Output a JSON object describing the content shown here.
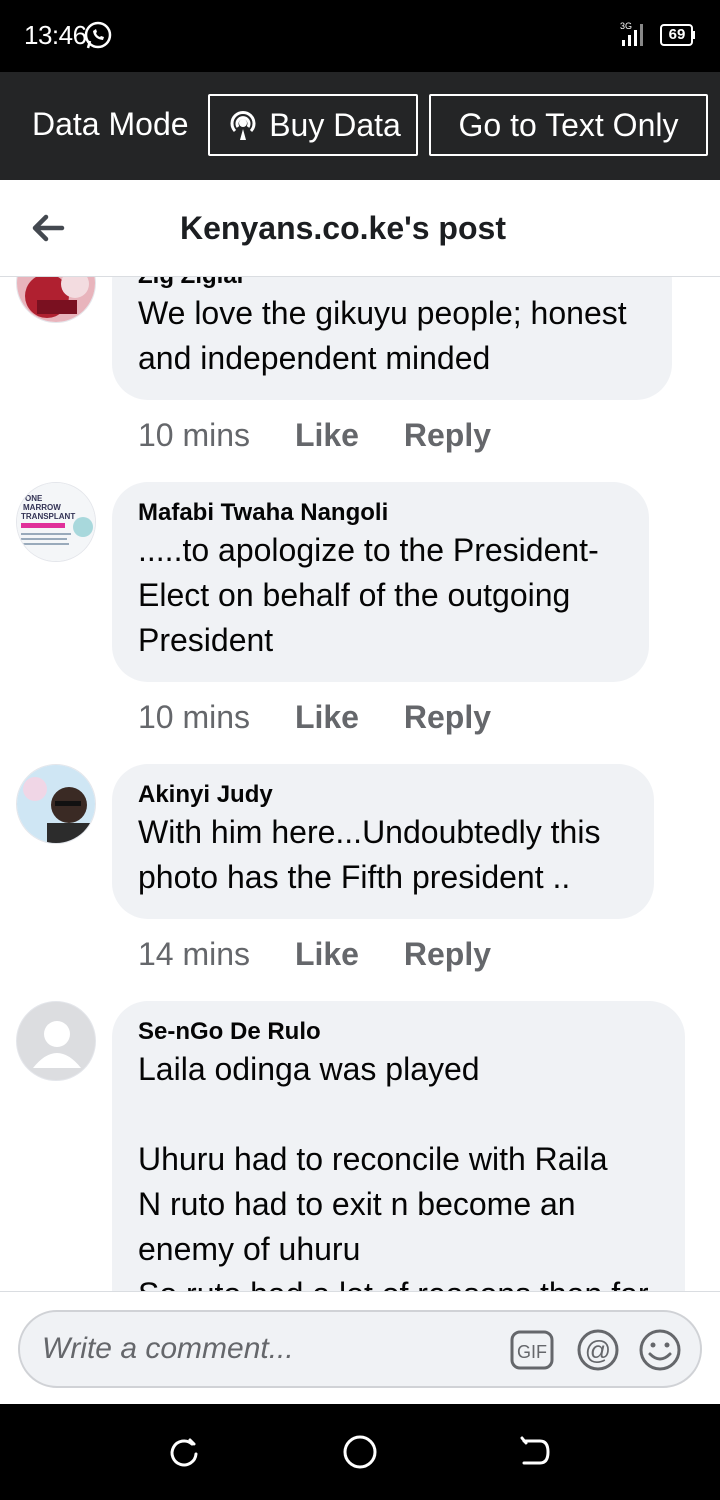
{
  "status_bar": {
    "time": "13:46",
    "network": "3G",
    "battery": "69"
  },
  "data_bar": {
    "label": "Data Mode",
    "buy_data": "Buy Data",
    "text_only": "Go to Text Only"
  },
  "header": {
    "title": "Kenyans.co.ke's post"
  },
  "comments": [
    {
      "author": "Zig Zigiai",
      "text": "We love the gikuyu people; honest and independent minded",
      "time": "10 mins",
      "like": "Like",
      "reply": "Reply"
    },
    {
      "author": "Mafabi Twaha Nangoli",
      "text": ".....to apologize to the President-Elect on behalf of the outgoing President",
      "time": "10 mins",
      "like": "Like",
      "reply": "Reply"
    },
    {
      "author": "Akinyi Judy",
      "text": "With him here...Undoubtedly this photo has the Fifth president ..",
      "time": "14 mins",
      "like": "Like",
      "reply": "Reply"
    },
    {
      "author": "Se-nGo De Rulo",
      "text": "Laila odinga was played\n\nUhuru had to reconcile with Raila\nN ruto had to exit n become an enemy of uhuru\nSo ruto had a lot of reasons than far"
    }
  ],
  "avatar2_text": {
    "line1": "ONE",
    "line2": "MARROW",
    "line3": "TRANSPLANT"
  },
  "composer": {
    "placeholder": "Write a comment...",
    "gif_label": "GIF"
  },
  "colors": {
    "bubble": "#f0f2f5",
    "meta": "#65676b",
    "data_bar": "#242526"
  }
}
